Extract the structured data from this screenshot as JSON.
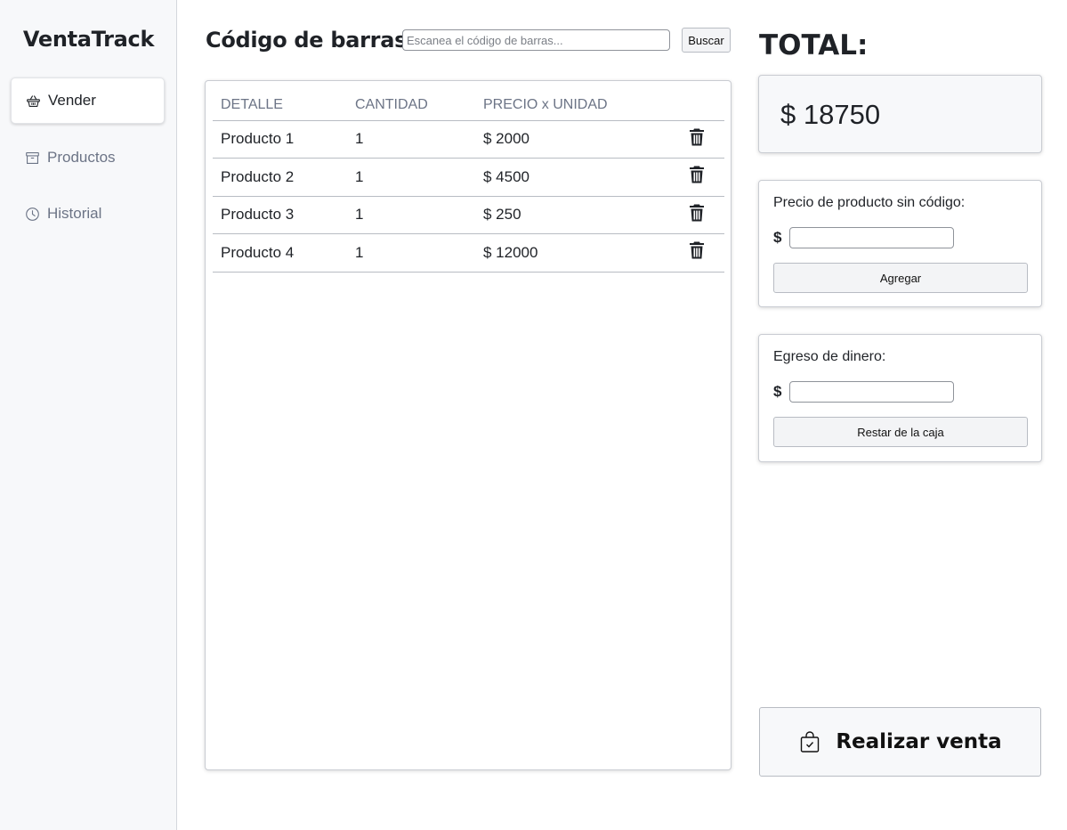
{
  "app": {
    "brand": "VentaTrack"
  },
  "sidebar": {
    "items": [
      {
        "label": "Vender",
        "icon": "basket-icon",
        "active": true
      },
      {
        "label": "Productos",
        "icon": "archive-icon",
        "active": false
      },
      {
        "label": "Historial",
        "icon": "clock-icon",
        "active": false
      }
    ]
  },
  "search": {
    "label": "Código de barras:",
    "placeholder": "Escanea el código de barras...",
    "value": "",
    "button_label": "Buscar"
  },
  "table": {
    "headers": [
      "DETALLE",
      "CANTIDAD",
      "PRECIO x UNIDAD"
    ],
    "rows": [
      {
        "detalle": "Producto 1",
        "cantidad": "1",
        "precio": "$ 2000"
      },
      {
        "detalle": "Producto 2",
        "cantidad": "1",
        "precio": "$ 4500"
      },
      {
        "detalle": "Producto 3",
        "cantidad": "1",
        "precio": "$ 250"
      },
      {
        "detalle": "Producto 4",
        "cantidad": "1",
        "precio": "$ 12000"
      }
    ],
    "delete_icon": "trash-icon"
  },
  "total": {
    "title": "TOTAL:",
    "value": "$ 18750"
  },
  "sin_codigo": {
    "label": "Precio de producto sin código:",
    "currency": "$",
    "value": "",
    "button_label": "Agregar"
  },
  "egreso": {
    "label": "Egreso de dinero:",
    "currency": "$",
    "value": "",
    "button_label": "Restar de la caja"
  },
  "sale": {
    "button_label": "Realizar venta",
    "icon": "shopping-bag-check-icon"
  }
}
